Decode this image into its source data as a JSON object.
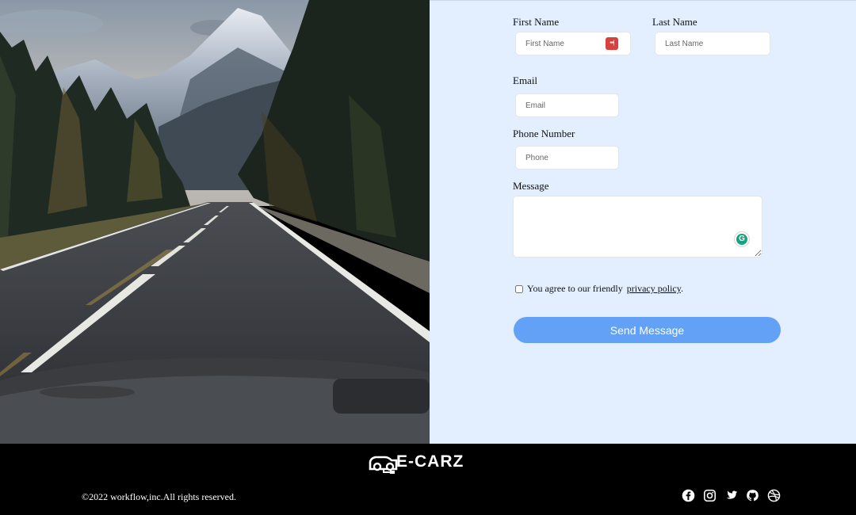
{
  "form": {
    "first_name": {
      "label": "First Name",
      "placeholder": "First Name"
    },
    "last_name": {
      "label": "Last Name",
      "placeholder": "Last Name"
    },
    "email": {
      "label": "Email",
      "placeholder": "Email"
    },
    "phone": {
      "label": "Phone Number",
      "placeholder": "Phone"
    },
    "message": {
      "label": "Message",
      "value": ""
    },
    "agree": {
      "text": "You agree to our friendly",
      "link": "privacy policy",
      "suffix": ".",
      "checked": false
    },
    "submit_label": "Send Message",
    "password_manager_badge": "•••|",
    "grammarly_badge": "G"
  },
  "footer": {
    "brand": "E-CARZ",
    "copyright": "©2022 workflow,inc.All rights reserved.",
    "socials": [
      {
        "icon": "facebook-icon"
      },
      {
        "icon": "instagram-icon"
      },
      {
        "icon": "twitter-icon"
      },
      {
        "icon": "github-icon"
      },
      {
        "icon": "dribbble-icon"
      }
    ]
  },
  "colors": {
    "panel_background": "#e3eefe",
    "button": "#62a1f5",
    "footer_background": "#000000"
  }
}
